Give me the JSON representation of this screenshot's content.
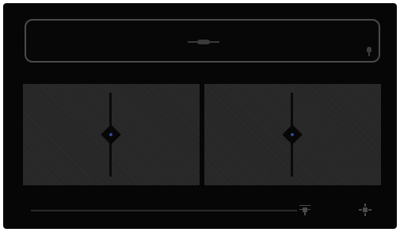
{
  "window": {
    "background": "#060606",
    "display_border_color": "#4a4a4a",
    "accent_color": "#2b4e9a"
  },
  "display": {
    "icon": "microphone-icon",
    "handle_icon": "grip-handle-icon"
  },
  "pads": [
    {
      "name": "left-pad",
      "slider_value": 0.5
    },
    {
      "name": "right-pad",
      "slider_value": 0.5
    }
  ],
  "bottom_bar": {
    "slider_value": 1.0,
    "icons": [
      "sliders-icon",
      "settings-icon"
    ]
  }
}
